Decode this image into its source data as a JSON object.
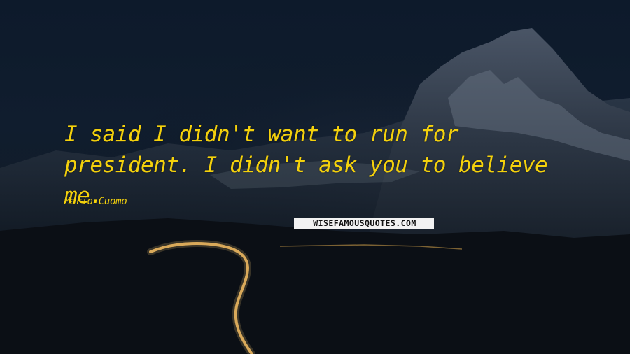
{
  "quote": {
    "text": "I said I didn't want to run for president. I didn't ask you to believe me.",
    "author": "Mario Cuomo"
  },
  "watermark": {
    "text": "WISEFAMOUSQUOTES.COM"
  },
  "colors": {
    "text": "#f4d10c",
    "sky": "#0d1a2b",
    "road_glow": "#e8b25a"
  }
}
